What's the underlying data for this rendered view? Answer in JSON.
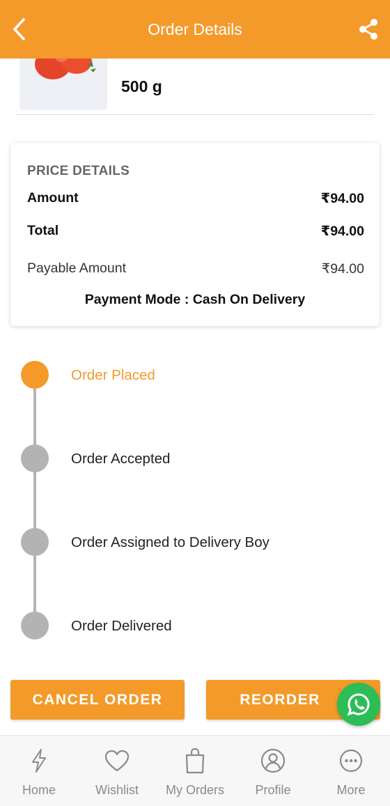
{
  "header": {
    "title": "Order Details",
    "back_icon": "chevron-left-icon",
    "share_icon": "share-icon",
    "bg_color": "#f39a2b"
  },
  "product": {
    "quantity": "500 g"
  },
  "price_details": {
    "heading": "PRICE DETAILS",
    "rows": [
      {
        "label": "Amount",
        "value": "₹94.00"
      },
      {
        "label": "Total",
        "value": "₹94.00"
      },
      {
        "label": "Payable Amount",
        "value": "₹94.00"
      }
    ],
    "payment_mode": "Payment Mode : Cash On Delivery"
  },
  "timeline": {
    "steps": [
      {
        "label": "Order Placed",
        "active": true
      },
      {
        "label": "Order Accepted",
        "active": false
      },
      {
        "label": "Order Assigned to Delivery Boy",
        "active": false
      },
      {
        "label": "Order Delivered",
        "active": false
      }
    ],
    "active_color": "#f39a2b",
    "inactive_color": "#b3b3b3"
  },
  "actions": {
    "cancel_label": "CANCEL ORDER",
    "reorder_label": "REORDER",
    "whatsapp_icon": "whatsapp-icon"
  },
  "bottom_nav": {
    "items": [
      {
        "label": "Home",
        "icon": "lightning-icon"
      },
      {
        "label": "Wishlist",
        "icon": "heart-icon"
      },
      {
        "label": "My Orders",
        "icon": "shopping-bag-icon"
      },
      {
        "label": "Profile",
        "icon": "user-icon"
      },
      {
        "label": "More",
        "icon": "more-icon"
      }
    ]
  }
}
